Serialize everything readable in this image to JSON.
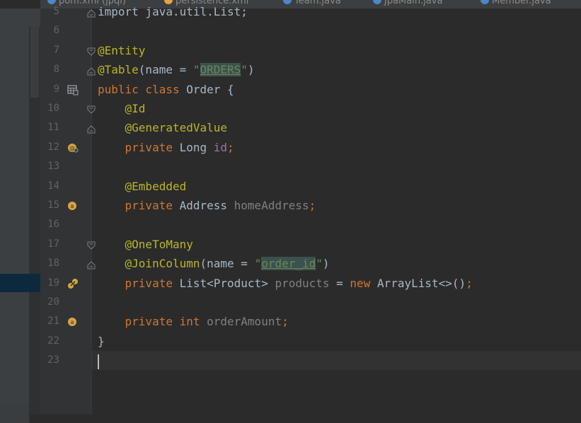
{
  "tabs": [
    {
      "label": "pom.xml (jpql)",
      "icon_color": "#4a88c7"
    },
    {
      "label": "persistence.xml",
      "icon_color": "#e8a33d"
    },
    {
      "label": "Team.java",
      "icon_color": "#4a88c7"
    },
    {
      "label": "JpaMain.java",
      "icon_color": "#4a88c7"
    },
    {
      "label": "Member.java",
      "icon_color": "#4a88c7"
    }
  ],
  "lines": [
    {
      "num": "5",
      "code": [
        {
          "t": "import java.util.List;",
          "c": "plain"
        }
      ]
    },
    {
      "num": "6",
      "code": []
    },
    {
      "num": "7",
      "code": [
        {
          "t": "@Entity",
          "c": "ann"
        }
      ]
    },
    {
      "num": "8",
      "code": [
        {
          "t": "@Table",
          "c": "ann"
        },
        {
          "t": "(name = ",
          "c": "plain"
        },
        {
          "t": "\"",
          "c": "str"
        },
        {
          "t": "ORDERS",
          "c": "strhl"
        },
        {
          "t": "\"",
          "c": "str"
        },
        {
          "t": ")",
          "c": "plain"
        }
      ]
    },
    {
      "num": "9",
      "code": [
        {
          "t": "public class ",
          "c": "kw"
        },
        {
          "t": "Order {",
          "c": "plain"
        }
      ]
    },
    {
      "num": "10",
      "code": [
        {
          "t": "    @Id",
          "c": "ann"
        }
      ]
    },
    {
      "num": "11",
      "code": [
        {
          "t": "    @GeneratedValue",
          "c": "ann"
        }
      ]
    },
    {
      "num": "12",
      "code": [
        {
          "t": "    private ",
          "c": "kw"
        },
        {
          "t": "Long ",
          "c": "plain"
        },
        {
          "t": "id",
          "c": "fld"
        },
        {
          "t": ";",
          "c": "kw"
        }
      ]
    },
    {
      "num": "13",
      "code": []
    },
    {
      "num": "14",
      "code": [
        {
          "t": "    @Embedded",
          "c": "ann"
        }
      ]
    },
    {
      "num": "15",
      "code": [
        {
          "t": "    private ",
          "c": "kw"
        },
        {
          "t": "Address ",
          "c": "plain"
        },
        {
          "t": "homeAddress",
          "c": "fldg"
        },
        {
          "t": ";",
          "c": "kw"
        }
      ]
    },
    {
      "num": "16",
      "code": []
    },
    {
      "num": "17",
      "code": [
        {
          "t": "    @OneToMany",
          "c": "ann"
        }
      ]
    },
    {
      "num": "18",
      "code": [
        {
          "t": "    @JoinColumn",
          "c": "ann"
        },
        {
          "t": "(name = ",
          "c": "plain"
        },
        {
          "t": "\"",
          "c": "str"
        },
        {
          "t": "order_id",
          "c": "strhl"
        },
        {
          "t": "\"",
          "c": "str"
        },
        {
          "t": ")",
          "c": "plain"
        }
      ]
    },
    {
      "num": "19",
      "code": [
        {
          "t": "    private ",
          "c": "kw"
        },
        {
          "t": "List<Product> ",
          "c": "plain"
        },
        {
          "t": "products ",
          "c": "fldg"
        },
        {
          "t": "= ",
          "c": "plain"
        },
        {
          "t": "new ",
          "c": "kw"
        },
        {
          "t": "ArrayList<>()",
          "c": "plain"
        },
        {
          "t": ";",
          "c": "kw"
        }
      ]
    },
    {
      "num": "20",
      "code": []
    },
    {
      "num": "21",
      "code": [
        {
          "t": "    private int ",
          "c": "kw"
        },
        {
          "t": "orderAmount",
          "c": "fldg"
        },
        {
          "t": ";",
          "c": "kw"
        }
      ]
    },
    {
      "num": "22",
      "code": [
        {
          "t": "}",
          "c": "plain"
        }
      ]
    },
    {
      "num": "23",
      "code": []
    }
  ],
  "gutter_icons": {
    "9": "entity-table-icon",
    "12": "id-field-icon",
    "15": "attribute-field-icon",
    "19": "relation-field-icon",
    "21": "attribute-field-icon"
  },
  "fold_markers": {
    "5": "end",
    "7": "start",
    "8": "end",
    "10": "start",
    "11": "end",
    "17": "start",
    "18": "end"
  },
  "colors": {
    "keyword": "#cc7832",
    "annotation": "#bbb529",
    "string": "#6a8759",
    "field": "#9876aa",
    "unused_field": "#808080",
    "text": "#a9b7c6"
  }
}
